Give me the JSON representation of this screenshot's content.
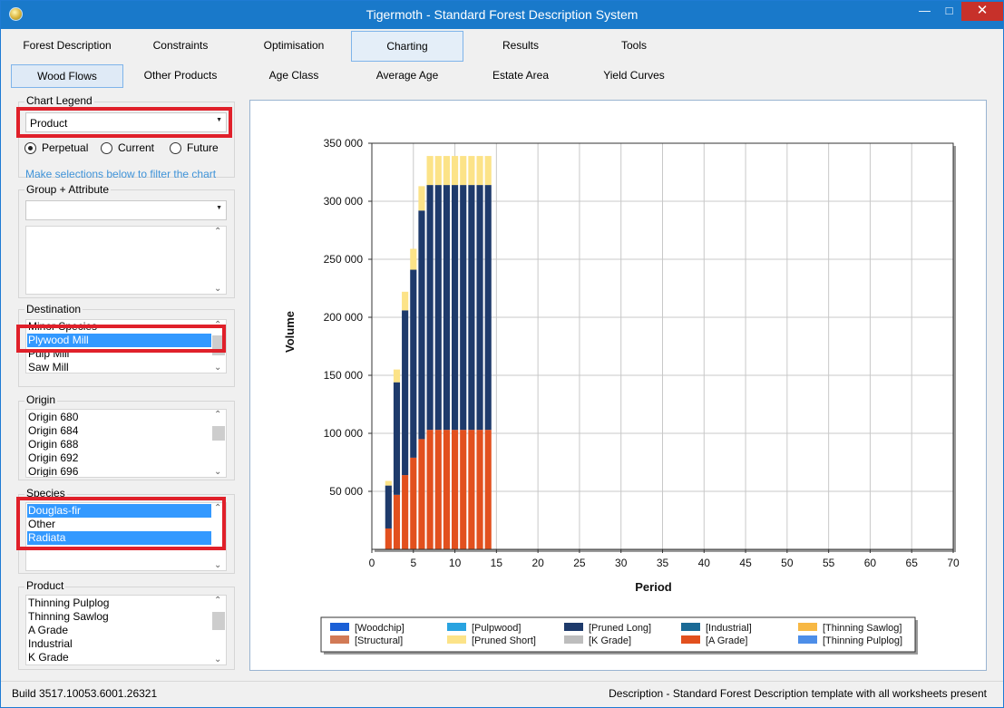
{
  "window": {
    "title": "Tigermoth - Standard Forest Description System",
    "min": "—",
    "max": "□",
    "close": "✕"
  },
  "tabs_main": [
    "Forest Description",
    "Constraints",
    "Optimisation",
    "Charting",
    "Results",
    "Tools"
  ],
  "tabs_main_active": "Charting",
  "tabs_sub": [
    "Wood Flows",
    "Other Products",
    "Age Class",
    "Average Age",
    "Estate Area",
    "Yield Curves"
  ],
  "tabs_sub_active": "Wood Flows",
  "sidebar": {
    "legend_label": "Chart Legend",
    "legend_value": "Product",
    "radio": {
      "perpetual": "Perpetual",
      "current": "Current",
      "future": "Future",
      "selected": "Perpetual"
    },
    "hint": "Make selections below to filter the chart",
    "group_label": "Group + Attribute",
    "destination_label": "Destination",
    "destination_items": [
      "Minor Species",
      "Plywood Mill",
      "Pulp Mill",
      "Saw Mill"
    ],
    "origin_label": "Origin",
    "origin_items": [
      "Origin 680",
      "Origin 684",
      "Origin 688",
      "Origin 692",
      "Origin 696"
    ],
    "species_label": "Species",
    "species_items": [
      "Douglas-fir",
      "Other",
      "Radiata"
    ],
    "product_label": "Product",
    "product_items": [
      "Thinning Pulplog",
      "Thinning Sawlog",
      "A Grade",
      "Industrial",
      "K Grade"
    ]
  },
  "status": {
    "build": "Build 3517.10053.6001.26321",
    "description": "Description - Standard Forest Description template with all worksheets present"
  },
  "colors": {
    "accent": "#1979ca",
    "highlight": "#3399ff",
    "red_callout": "#e0202a"
  },
  "chart_data": {
    "type": "bar",
    "stacked": true,
    "xlabel": "Period",
    "ylabel": "Volume",
    "xlim": [
      0,
      70
    ],
    "ylim": [
      0,
      350000
    ],
    "xticks": [
      "0",
      "5",
      "10",
      "15",
      "20",
      "25",
      "30",
      "35",
      "40",
      "45",
      "50",
      "55",
      "60",
      "65",
      "70"
    ],
    "yticks": [
      "50 000",
      "100 000",
      "150 000",
      "200 000",
      "250 000",
      "300 000",
      "350 000"
    ],
    "grid": true,
    "legend_position": "bottom",
    "x": [
      2,
      3,
      4,
      5,
      6,
      7,
      8,
      9,
      10,
      11,
      12,
      13,
      14
    ],
    "series": [
      {
        "name": "[Woodchip]",
        "color": "#1a5fd6",
        "values": [
          0,
          0,
          0,
          0,
          0,
          0,
          0,
          0,
          0,
          0,
          0,
          0,
          0
        ]
      },
      {
        "name": "[Structural]",
        "color": "#d27a56",
        "values": [
          0,
          0,
          0,
          0,
          0,
          0,
          0,
          0,
          0,
          0,
          0,
          0,
          0
        ]
      },
      {
        "name": "[Pulpwood]",
        "color": "#29a3e0",
        "values": [
          0,
          0,
          0,
          0,
          0,
          0,
          0,
          0,
          0,
          0,
          0,
          0,
          0
        ]
      },
      {
        "name": "[Pruned Short]",
        "color": "#fce388",
        "values": [
          4000,
          11000,
          16000,
          18000,
          21000,
          25000,
          25000,
          25000,
          25000,
          25000,
          25000,
          25000,
          25000
        ]
      },
      {
        "name": "[Pruned Long]",
        "color": "#1e3a6b",
        "values": [
          37000,
          97000,
          142000,
          162000,
          197000,
          211000,
          211000,
          211000,
          211000,
          211000,
          211000,
          211000,
          211000
        ]
      },
      {
        "name": "[K Grade]",
        "color": "#bdbdbd",
        "values": [
          0,
          0,
          0,
          0,
          0,
          0,
          0,
          0,
          0,
          0,
          0,
          0,
          0
        ]
      },
      {
        "name": "[Industrial]",
        "color": "#1a6a96",
        "values": [
          0,
          0,
          0,
          0,
          0,
          0,
          0,
          0,
          0,
          0,
          0,
          0,
          0
        ]
      },
      {
        "name": "[A Grade]",
        "color": "#e2501e",
        "values": [
          18000,
          47000,
          64000,
          79000,
          95000,
          103000,
          103000,
          103000,
          103000,
          103000,
          103000,
          103000,
          103000
        ]
      },
      {
        "name": "[Thinning Sawlog]",
        "color": "#f7b844",
        "values": [
          0,
          0,
          0,
          0,
          0,
          0,
          0,
          0,
          0,
          0,
          0,
          0,
          0
        ]
      },
      {
        "name": "[Thinning Pulplog]",
        "color": "#4d8ee8",
        "values": [
          0,
          0,
          0,
          0,
          0,
          0,
          0,
          0,
          0,
          0,
          0,
          0,
          0
        ]
      }
    ],
    "stack_order": [
      "[A Grade]",
      "[Pruned Long]",
      "[Pruned Short]"
    ]
  }
}
